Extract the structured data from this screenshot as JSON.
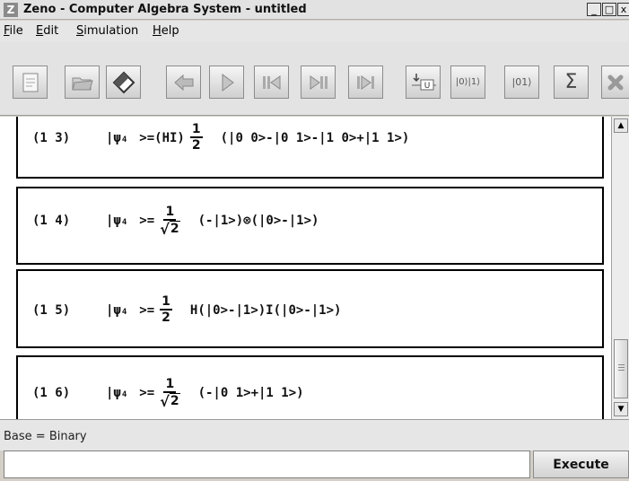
{
  "window": {
    "app_icon_letter": "Z",
    "title": "Zeno - Computer Algebra System - untitled",
    "minimize": "_",
    "maximize": "□",
    "close": "x"
  },
  "menu": [
    "File",
    "Edit",
    "Simulation",
    "Help"
  ],
  "toolbar": {
    "buttons": [
      {
        "name": "new-document-icon"
      },
      {
        "name": "open-folder-icon"
      },
      {
        "name": "eraser-icon"
      },
      {
        "name": "back-arrow-icon"
      },
      {
        "name": "play-icon"
      },
      {
        "name": "rewind-to-start-icon"
      },
      {
        "name": "step-forward-icon"
      },
      {
        "name": "fast-forward-end-icon"
      },
      {
        "name": "apply-unitary-icon",
        "label": "U"
      },
      {
        "name": "basis-kets-icon",
        "label": "|0⟩|1⟩"
      },
      {
        "name": "tensor-ket-icon",
        "label": "|01⟩"
      },
      {
        "name": "summation-icon",
        "label": "Σ"
      },
      {
        "name": "close-icon"
      }
    ]
  },
  "cells": [
    {
      "label": "(1 3)",
      "state": "|ψ",
      "sub": "4",
      "eq": ">=",
      "prefix": "(HI)",
      "num": "1",
      "den": "2",
      "expr": "(|0 0>-|0 1>-|1 0>+|1 1>)"
    },
    {
      "label": "(1 4)",
      "state": "|ψ",
      "sub": "4",
      "eq": ">=",
      "num": "1",
      "den": "2",
      "expr": "(-|1>)⊗(|0>-|1>)"
    },
    {
      "label": "(1 5)",
      "state": "|ψ",
      "sub": "4",
      "eq": ">=",
      "num": "1",
      "den": "2",
      "expr": "H(|0>-|1>)I(|0>-|1>)"
    },
    {
      "label": "(1 6)",
      "state": "|ψ",
      "sub": "4",
      "eq": ">=",
      "num": "1",
      "den": "2",
      "expr": "(-|0 1>+|1 1>)"
    }
  ],
  "status": "Base = Binary",
  "input": {
    "value": ""
  },
  "execute": "Execute"
}
